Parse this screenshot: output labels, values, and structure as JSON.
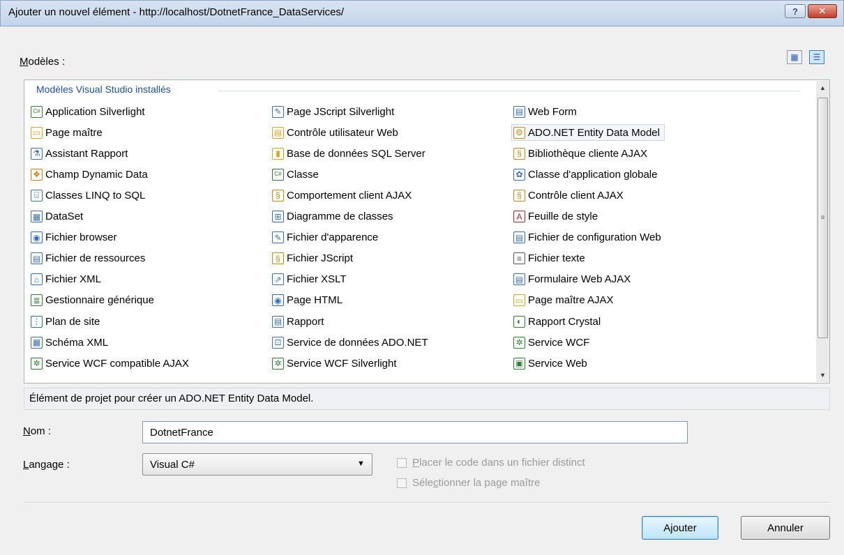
{
  "window": {
    "title": "Ajouter un nouvel élément - http://localhost/DotnetFrance_DataServices/",
    "help_label": "?",
    "close_label": "✕"
  },
  "templates_label_u": "M",
  "templates_label_rest": "odèles :",
  "group_header": "Modèles Visual Studio installés",
  "columns": [
    [
      {
        "label": "Application Silverlight",
        "icon": "silverlight-app-icon",
        "glyph": "C#",
        "color": "#2f7d32"
      },
      {
        "label": "Page maître",
        "icon": "master-page-icon",
        "glyph": "▭",
        "color": "#e0a21b"
      },
      {
        "label": "Assistant Rapport",
        "icon": "report-wizard-icon",
        "glyph": "⚗",
        "color": "#3a6fb0"
      },
      {
        "label": "Champ Dynamic Data",
        "icon": "dynamic-data-icon",
        "glyph": "❖",
        "color": "#d47b12"
      },
      {
        "label": "Classes LINQ to SQL",
        "icon": "linq-icon",
        "glyph": "⌸",
        "color": "#3a6fb0"
      },
      {
        "label": "DataSet",
        "icon": "dataset-icon",
        "glyph": "▦",
        "color": "#3a6fb0"
      },
      {
        "label": "Fichier browser",
        "icon": "browser-file-icon",
        "glyph": "◉",
        "color": "#2b6cc4"
      },
      {
        "label": "Fichier de ressources",
        "icon": "resource-file-icon",
        "glyph": "▤",
        "color": "#3a6fb0"
      },
      {
        "label": "Fichier XML",
        "icon": "xml-file-icon",
        "glyph": "⌂",
        "color": "#2b6cc4"
      },
      {
        "label": "Gestionnaire générique",
        "icon": "handler-icon",
        "glyph": "≣",
        "color": "#2f7d32"
      },
      {
        "label": "Plan de site",
        "icon": "sitemap-icon",
        "glyph": "⋮",
        "color": "#2b6cc4"
      },
      {
        "label": "Schéma XML",
        "icon": "xml-schema-icon",
        "glyph": "▦",
        "color": "#3a6fb0"
      },
      {
        "label": "Service WCF compatible AJAX",
        "icon": "wcf-ajax-icon",
        "glyph": "✲",
        "color": "#2f7d32"
      }
    ],
    [
      {
        "label": "Page JScript Silverlight",
        "icon": "jscript-silverlight-icon",
        "glyph": "✎",
        "color": "#3a6fb0"
      },
      {
        "label": "Contrôle utilisateur Web",
        "icon": "user-control-icon",
        "glyph": "▤",
        "color": "#e0a21b"
      },
      {
        "label": "Base de données SQL Server",
        "icon": "database-icon",
        "glyph": "▮",
        "color": "#e0a21b"
      },
      {
        "label": "Classe",
        "icon": "class-icon",
        "glyph": "C#",
        "color": "#2f7d32"
      },
      {
        "label": "Comportement client AJAX",
        "icon": "ajax-behavior-icon",
        "glyph": "§",
        "color": "#c88a10"
      },
      {
        "label": "Diagramme de classes",
        "icon": "class-diagram-icon",
        "glyph": "⊞",
        "color": "#3a6fb0"
      },
      {
        "label": "Fichier d'apparence",
        "icon": "skin-file-icon",
        "glyph": "✎",
        "color": "#3a6fb0"
      },
      {
        "label": "Fichier JScript",
        "icon": "jscript-file-icon",
        "glyph": "§",
        "color": "#c88a10"
      },
      {
        "label": "Fichier XSLT",
        "icon": "xslt-file-icon",
        "glyph": "⇗",
        "color": "#3a6fb0"
      },
      {
        "label": "Page HTML",
        "icon": "html-page-icon",
        "glyph": "◉",
        "color": "#2b6cc4"
      },
      {
        "label": "Rapport",
        "icon": "report-icon",
        "glyph": "▤",
        "color": "#3a6fb0"
      },
      {
        "label": "Service de données ADO.NET",
        "icon": "data-service-icon",
        "glyph": "⊡",
        "color": "#3a6fb0"
      },
      {
        "label": "Service WCF Silverlight",
        "icon": "wcf-silverlight-icon",
        "glyph": "✲",
        "color": "#2f7d32"
      }
    ],
    [
      {
        "label": "Web Form",
        "icon": "web-form-icon",
        "glyph": "▤",
        "color": "#3a6fb0"
      },
      {
        "label": "ADO.NET Entity Data Model",
        "icon": "entity-model-icon",
        "glyph": "⚙",
        "color": "#c88a10",
        "selected": true
      },
      {
        "label": "Bibliothèque cliente AJAX",
        "icon": "ajax-library-icon",
        "glyph": "§",
        "color": "#c88a10"
      },
      {
        "label": "Classe d'application globale",
        "icon": "global-app-icon",
        "glyph": "✿",
        "color": "#3a6fb0"
      },
      {
        "label": "Contrôle client AJAX",
        "icon": "ajax-control-icon",
        "glyph": "§",
        "color": "#c88a10"
      },
      {
        "label": "Feuille de style",
        "icon": "stylesheet-icon",
        "glyph": "A",
        "color": "#b22222"
      },
      {
        "label": "Fichier de configuration Web",
        "icon": "web-config-icon",
        "glyph": "▤",
        "color": "#3a6fb0"
      },
      {
        "label": "Fichier texte",
        "icon": "text-file-icon",
        "glyph": "≡",
        "color": "#555555"
      },
      {
        "label": "Formulaire Web AJAX",
        "icon": "ajax-form-icon",
        "glyph": "▤",
        "color": "#3a6fb0"
      },
      {
        "label": "Page maître AJAX",
        "icon": "ajax-master-page-icon",
        "glyph": "▭",
        "color": "#e0a21b"
      },
      {
        "label": "Rapport Crystal",
        "icon": "crystal-report-icon",
        "glyph": "◐",
        "color": "#2f7d32"
      },
      {
        "label": "Service WCF",
        "icon": "wcf-service-icon",
        "glyph": "✲",
        "color": "#2f7d32"
      },
      {
        "label": "Service Web",
        "icon": "web-service-icon",
        "glyph": "▣",
        "color": "#2f7d32"
      }
    ]
  ],
  "description": "Élément de projet pour créer un ADO.NET Entity Data Model.",
  "name_field": {
    "label_u": "N",
    "label_rest": "om :",
    "value": "DotnetFrance"
  },
  "language_field": {
    "label_u": "L",
    "label_rest": "angage :",
    "value": "Visual C#"
  },
  "checkbox_separate_code": {
    "label_u": "P",
    "label_rest": "lacer le code dans un fichier distinct",
    "checked": false
  },
  "checkbox_master_page": {
    "label_pre": "Séle",
    "label_u": "c",
    "label_rest": "tionner la page maître",
    "checked": false
  },
  "buttons": {
    "add": "Ajouter",
    "cancel": "Annuler"
  }
}
